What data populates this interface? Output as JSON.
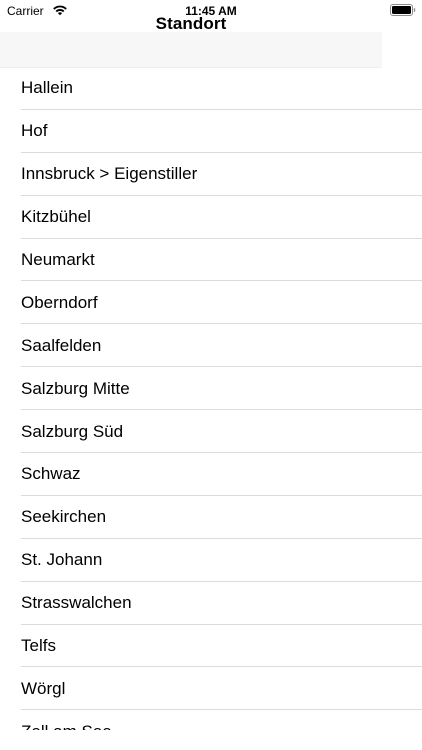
{
  "status_bar": {
    "carrier": "Carrier",
    "time": "11:45 AM",
    "icons": [
      "wifi-icon",
      "battery-icon"
    ]
  },
  "nav": {
    "title": "Standort"
  },
  "search": {
    "placeholder": ""
  },
  "locations": [
    {
      "label": "Hallein"
    },
    {
      "label": "Hof"
    },
    {
      "label": "Innsbruck > Eigenstiller"
    },
    {
      "label": "Kitzbühel"
    },
    {
      "label": "Neumarkt"
    },
    {
      "label": "Oberndorf"
    },
    {
      "label": "Saalfelden"
    },
    {
      "label": "Salzburg Mitte"
    },
    {
      "label": "Salzburg Süd"
    },
    {
      "label": "Schwaz"
    },
    {
      "label": "Seekirchen"
    },
    {
      "label": "St. Johann"
    },
    {
      "label": "Strasswalchen"
    },
    {
      "label": "Telfs"
    },
    {
      "label": "Wörgl"
    },
    {
      "label": "Zell am See"
    }
  ],
  "colors": {
    "background": "#ffffff",
    "text": "#000000",
    "separator": "#dcdcdc",
    "search_strip": "#f7f7f7"
  }
}
